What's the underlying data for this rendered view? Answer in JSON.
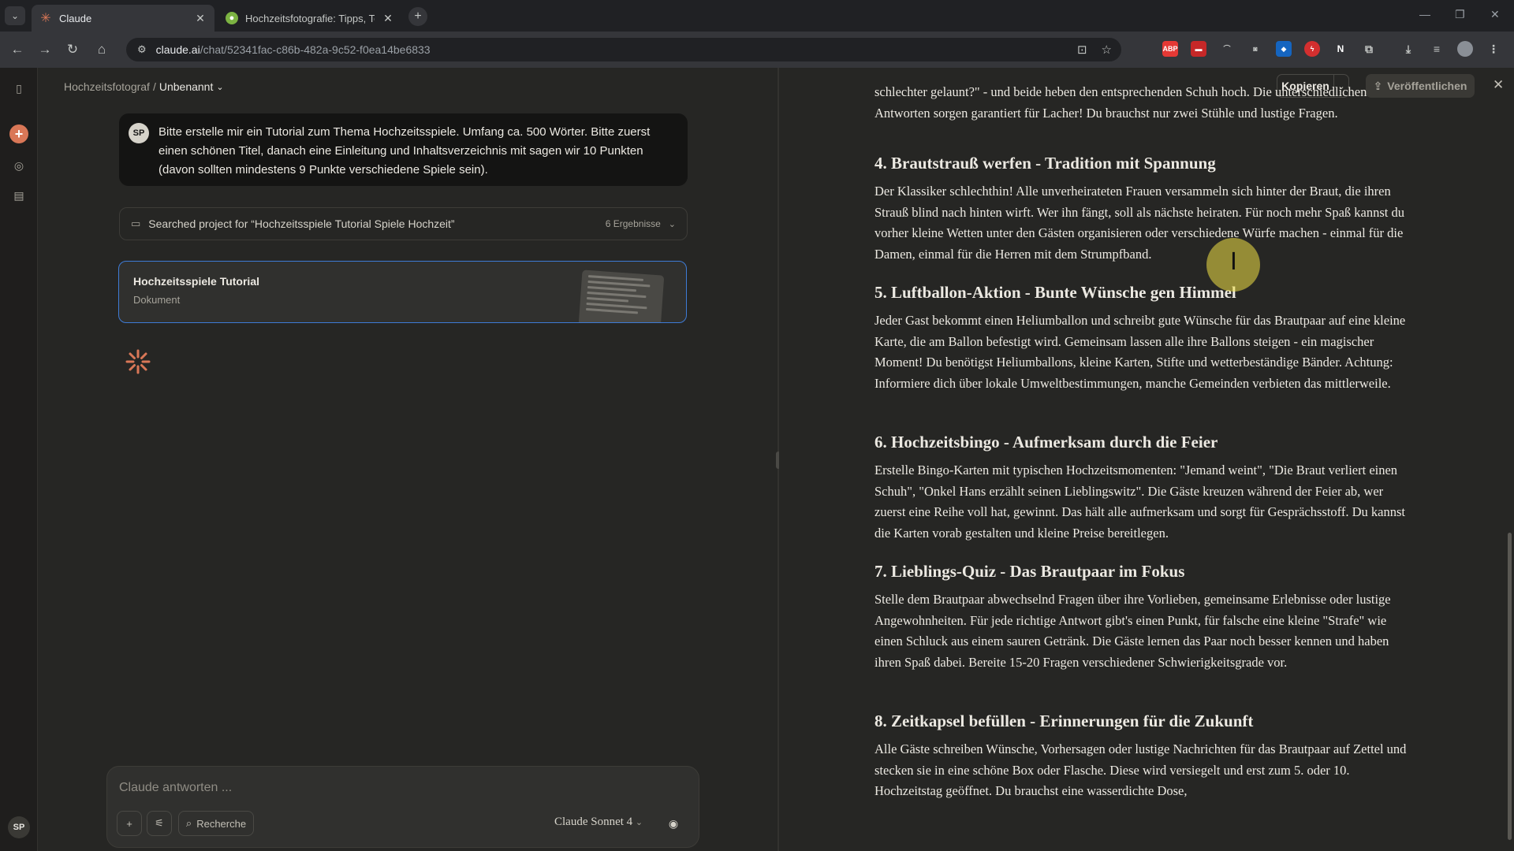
{
  "browser": {
    "tabs": [
      {
        "title": "Claude",
        "active": true
      },
      {
        "title": "Hochzeitsfotografie: Tipps, Tec",
        "active": false
      }
    ],
    "url_host": "claude.ai",
    "url_path": "/chat/52341fac-c86b-482a-9c52-f0ea14be6833",
    "extensions": [
      "ABP",
      "N"
    ]
  },
  "chat": {
    "breadcrumb": {
      "project": "Hochzeitsfotograf",
      "sep": "/",
      "current": "Unbenannt"
    },
    "user": {
      "initials": "SP",
      "message": "Bitte erstelle mir ein Tutorial zum Thema Hochzeitsspiele. Umfang ca. 500 Wörter. Bitte zuerst einen schönen Titel, danach eine Einleitung und Inhaltsverzeichnis mit sagen wir 10 Punkten (davon sollten mindestens 9 Punkte verschiedene Spiele sein)."
    },
    "search": {
      "label": "Searched project for “Hochzeitsspiele Tutorial Spiele Hochzeit”",
      "count": "6 Ergebnisse"
    },
    "doc_card": {
      "title": "Hochzeitsspiele Tutorial",
      "type": "Dokument"
    },
    "composer": {
      "placeholder": "Claude antworten ...",
      "research": "Recherche",
      "model": "Claude Sonnet 4"
    },
    "rail_avatar": "SP"
  },
  "artifact": {
    "copy": "Kopieren",
    "publish": "Veröffentlichen",
    "intro_tail": "schlechter gelaunt?\" - und beide heben den entsprechenden Schuh hoch. Die unterschiedlichen Antworten sorgen garantiert für Lacher! Du brauchst nur zwei Stühle und lustige Fragen.",
    "sections": [
      {
        "heading": "4. Brautstrauß werfen - Tradition mit Spannung",
        "body": "Der Klassiker schlechthin! Alle unverheirateten Frauen versammeln sich hinter der Braut, die ihren Strauß blind nach hinten wirft. Wer ihn fängt, soll als nächste heiraten. Für noch mehr Spaß kannst du vorher kleine Wetten unter den Gästen organisieren oder verschiedene Würfe machen - einmal für die Damen, einmal für die Herren mit dem Strumpfband."
      },
      {
        "heading": "5. Luftballon-Aktion - Bunte Wünsche gen Himmel",
        "body": "Jeder Gast bekommt einen Heliumballon und schreibt gute Wünsche für das Brautpaar auf eine kleine Karte, die am Ballon befestigt wird. Gemeinsam lassen alle ihre Ballons steigen - ein magischer Moment! Du benötigst Heliumballons, kleine Karten, Stifte und wetterbeständige Bänder. Achtung: Informiere dich über lokale Umweltbestimmungen, manche Gemeinden verbieten das mittlerweile."
      },
      {
        "heading": "6. Hochzeitsbingo - Aufmerksam durch die Feier",
        "body": "Erstelle Bingo-Karten mit typischen Hochzeitsmomenten: \"Jemand weint\", \"Die Braut verliert einen Schuh\", \"Onkel Hans erzählt seinen Lieblingswitz\". Die Gäste kreuzen während der Feier ab, wer zuerst eine Reihe voll hat, gewinnt. Das hält alle aufmerksam und sorgt für Gesprächsstoff. Du kannst die Karten vorab gestalten und kleine Preise bereitlegen."
      },
      {
        "heading": "7. Lieblings-Quiz - Das Brautpaar im Fokus",
        "body": "Stelle dem Brautpaar abwechselnd Fragen über ihre Vorlieben, gemeinsame Erlebnisse oder lustige Angewohnheiten. Für jede richtige Antwort gibt's einen Punkt, für falsche eine kleine \"Strafe\" wie einen Schluck aus einem sauren Getränk. Die Gäste lernen das Paar noch besser kennen und haben ihren Spaß dabei. Bereite 15-20 Fragen verschiedener Schwierigkeitsgrade vor."
      },
      {
        "heading": "8. Zeitkapsel befüllen - Erinnerungen für die Zukunft",
        "body": "Alle Gäste schreiben Wünsche, Vorhersagen oder lustige Nachrichten für das Brautpaar auf Zettel und stecken sie in eine schöne Box oder Flasche. Diese wird versiegelt und erst zum 5. oder 10. Hochzeitstag geöffnet. Du brauchst eine wasserdichte Dose,"
      }
    ]
  },
  "colors": {
    "accent": "#d97757",
    "selection": "#3e7bd6",
    "background": "#262624"
  }
}
